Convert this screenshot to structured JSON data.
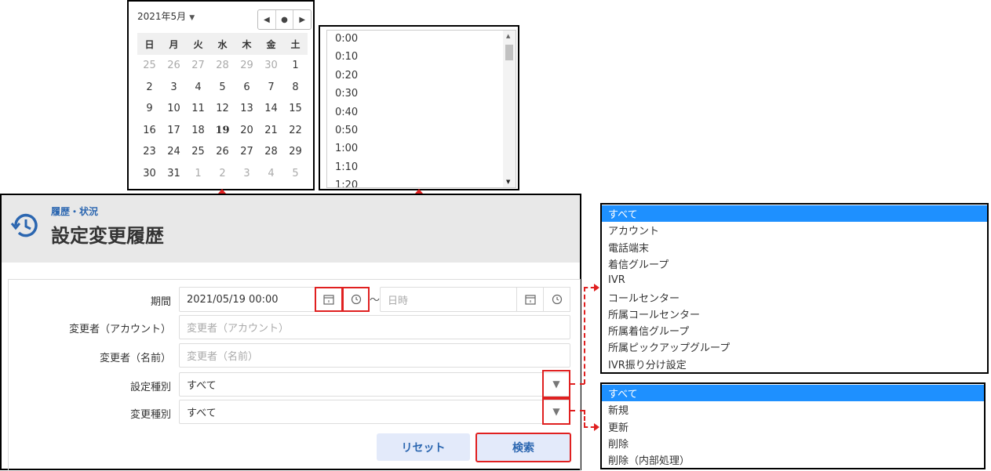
{
  "calendar": {
    "title": "2021年5月",
    "caret": "▼",
    "nav_prev": "◀",
    "nav_today": "●",
    "nav_next": "▶",
    "weekdays": [
      "日",
      "月",
      "火",
      "水",
      "木",
      "金",
      "土"
    ],
    "weeks": [
      [
        "25",
        "26",
        "27",
        "28",
        "29",
        "30",
        "1"
      ],
      [
        "2",
        "3",
        "4",
        "5",
        "6",
        "7",
        "8"
      ],
      [
        "9",
        "10",
        "11",
        "12",
        "13",
        "14",
        "15"
      ],
      [
        "16",
        "17",
        "18",
        "19",
        "20",
        "21",
        "22"
      ],
      [
        "23",
        "24",
        "25",
        "26",
        "27",
        "28",
        "29"
      ],
      [
        "30",
        "31",
        "1",
        "2",
        "3",
        "4",
        "5"
      ]
    ]
  },
  "time_list": [
    "0:00",
    "0:10",
    "0:20",
    "0:30",
    "0:40",
    "0:50",
    "1:00",
    "1:10",
    "1:20"
  ],
  "header": {
    "breadcrumb": "履歴・状況",
    "title": "設定変更履歴"
  },
  "form": {
    "period_label": "期間",
    "period_value": "2021/05/19 00:00",
    "tilde": "～",
    "period_end_placeholder": "日時",
    "changer_account_label": "変更者（アカウント）",
    "changer_account_placeholder": "変更者（アカウント）",
    "changer_name_label": "変更者（名前）",
    "changer_name_placeholder": "変更者（名前）",
    "setting_type_label": "設定種別",
    "setting_type_value": "すべて",
    "change_type_label": "変更種別",
    "change_type_value": "すべて",
    "reset_button": "リセット",
    "search_button": "検索"
  },
  "setting_type_options": [
    "すべて",
    "アカウント",
    "電話端末",
    "着信グループ",
    "IVR",
    "コールセンター",
    "所属コールセンター",
    "所属着信グループ",
    "所属ピックアップグループ",
    "IVR振り分け設定"
  ],
  "change_type_options": [
    "すべて",
    "新規",
    "更新",
    "削除",
    "削除（内部処理）"
  ],
  "colors": {
    "highlight": "#e02020",
    "accent": "#2b66b0",
    "selected": "#1e90ff"
  }
}
